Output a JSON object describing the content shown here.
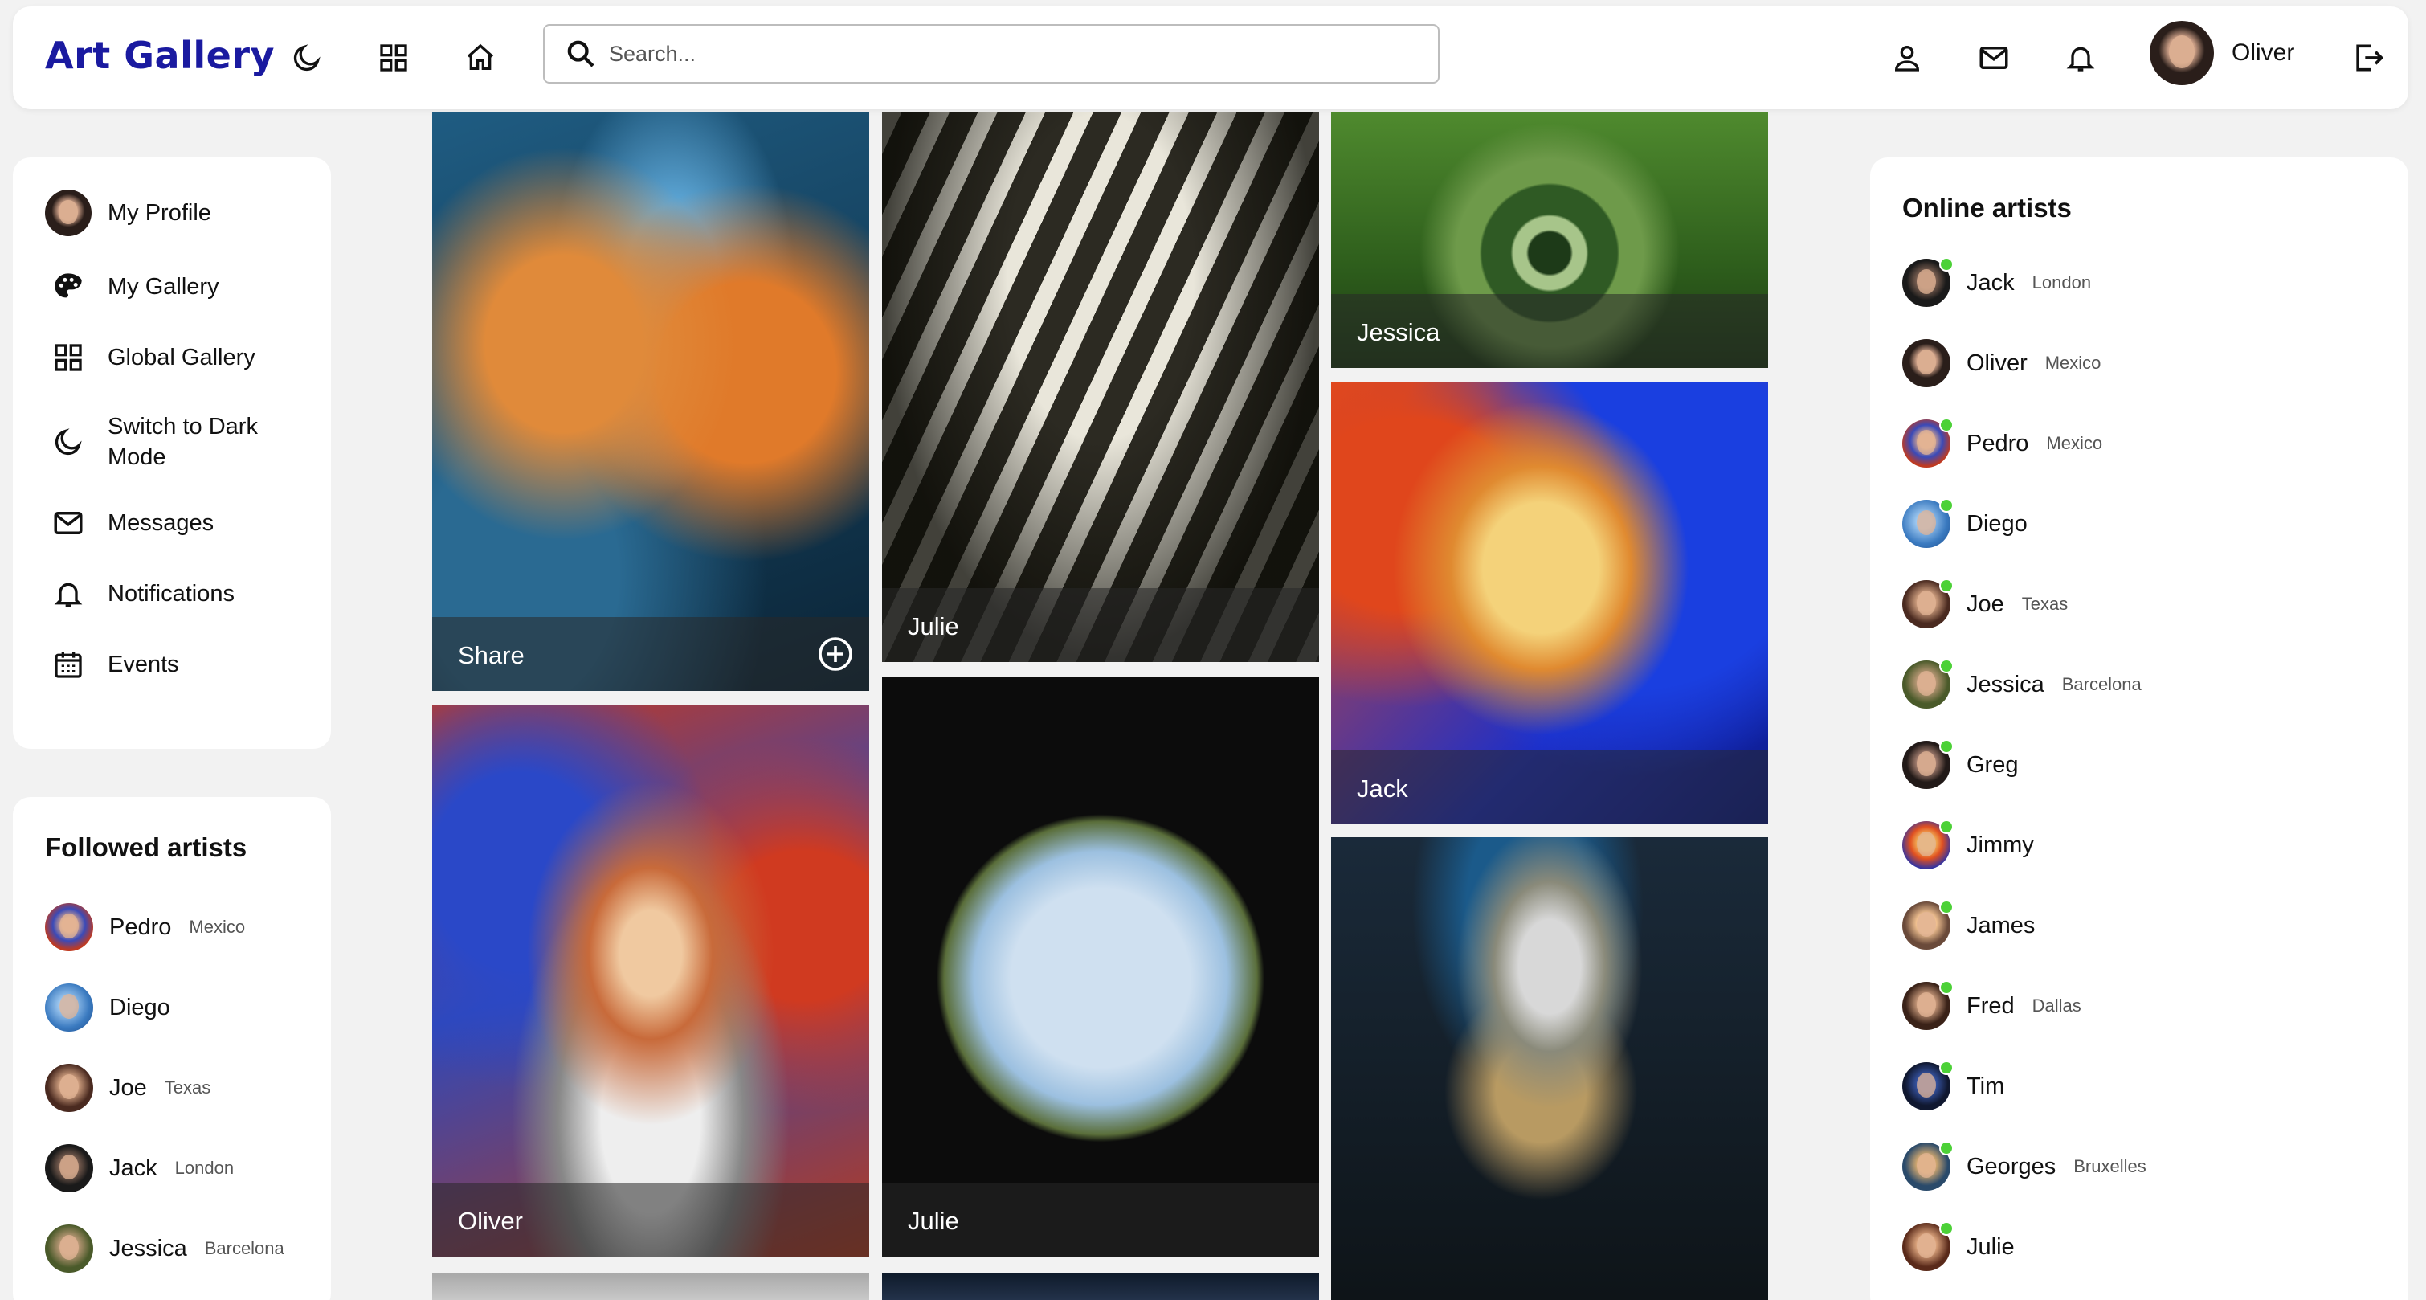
{
  "app": {
    "title": "Art Gallery"
  },
  "header": {
    "search_placeholder": "Search...",
    "user_name": "Oliver",
    "icons": [
      "moon-icon",
      "grid-icon",
      "home-icon",
      "search-icon",
      "user-icon",
      "mail-icon",
      "bell-icon",
      "logout-icon"
    ]
  },
  "menu": {
    "items": [
      {
        "label": "My Profile",
        "icon": "avatar"
      },
      {
        "label": "My Gallery",
        "icon": "palette-icon"
      },
      {
        "label": "Global Gallery",
        "icon": "grid-icon"
      },
      {
        "label": "Switch to Dark Mode",
        "icon": "moon-icon"
      },
      {
        "label": "Messages",
        "icon": "mail-icon"
      },
      {
        "label": "Notifications",
        "icon": "bell-icon"
      },
      {
        "label": "Events",
        "icon": "calendar-icon"
      }
    ]
  },
  "followed": {
    "title": "Followed artists",
    "artists": [
      {
        "name": "Pedro",
        "location": "Mexico"
      },
      {
        "name": "Diego",
        "location": ""
      },
      {
        "name": "Joe",
        "location": "Texas"
      },
      {
        "name": "Jack",
        "location": "London"
      },
      {
        "name": "Jessica",
        "location": "Barcelona"
      }
    ]
  },
  "online": {
    "title": "Online artists",
    "artists": [
      {
        "name": "Jack",
        "location": "London"
      },
      {
        "name": "Oliver",
        "location": "Mexico"
      },
      {
        "name": "Pedro",
        "location": "Mexico"
      },
      {
        "name": "Diego",
        "location": ""
      },
      {
        "name": "Joe",
        "location": "Texas"
      },
      {
        "name": "Jessica",
        "location": "Barcelona"
      },
      {
        "name": "Greg",
        "location": ""
      },
      {
        "name": "Jimmy",
        "location": ""
      },
      {
        "name": "James",
        "location": ""
      },
      {
        "name": "Fred",
        "location": "Dallas"
      },
      {
        "name": "Tim",
        "location": ""
      },
      {
        "name": "Georges",
        "location": "Bruxelles"
      },
      {
        "name": "Julie",
        "location": ""
      }
    ]
  },
  "gallery": {
    "cards": [
      {
        "caption": "Share"
      },
      {
        "caption": "Julie"
      },
      {
        "caption": "Jessica"
      },
      {
        "caption": "Jack"
      },
      {
        "caption": "Oliver"
      },
      {
        "caption": "Julie"
      },
      {
        "caption": ""
      },
      {
        "caption": ""
      },
      {
        "caption": ""
      }
    ]
  },
  "colors": {
    "brand": "#1a1aa0",
    "online": "#4cd137"
  }
}
